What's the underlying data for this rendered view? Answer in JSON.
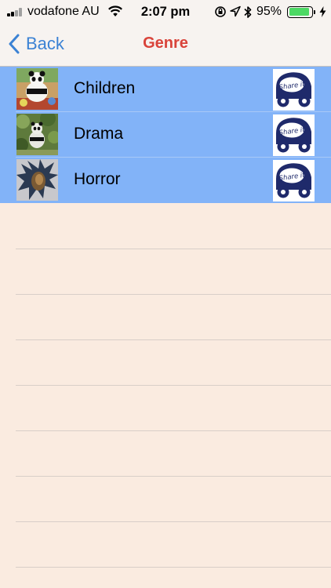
{
  "status_bar": {
    "carrier": "vodafone AU",
    "time": "2:07 pm",
    "battery_percent": "95%",
    "battery_level": 0.95,
    "icons": [
      "signal-icon",
      "wifi-icon",
      "orientation-lock-icon",
      "location-icon",
      "bluetooth-icon",
      "battery-icon",
      "charging-icon"
    ]
  },
  "nav": {
    "back_label": "Back",
    "title": "Genre"
  },
  "genres": [
    {
      "label": "Children",
      "thumbnail": "panda-toys-photo",
      "share_label": "Share it"
    },
    {
      "label": "Drama",
      "thumbnail": "panda-foliage-photo",
      "share_label": "Share it"
    },
    {
      "label": "Horror",
      "thumbnail": "dark-figure-photo",
      "share_label": "Share it"
    }
  ],
  "colors": {
    "background": "#faebe0",
    "row_highlight": "#82b3f8",
    "back_blue": "#3b82d4",
    "title_red": "#d9433a",
    "share_navy": "#1f2a6b"
  }
}
